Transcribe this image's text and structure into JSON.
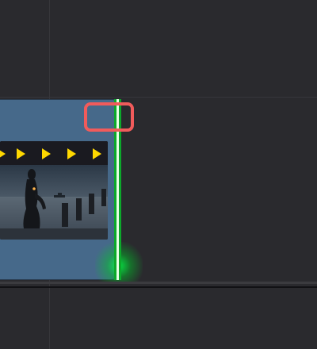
{
  "timeline": {
    "clip": {
      "name": "video-clip",
      "color": "#46698a",
      "filmstrip_marker_icon": "play-marker-icon",
      "marker_color": "#ffd800",
      "marker_count": 5
    },
    "edit_point": {
      "color": "#00ff46",
      "icon": "trim-edge-icon"
    },
    "highlight": {
      "color": "#f15b5b"
    }
  }
}
